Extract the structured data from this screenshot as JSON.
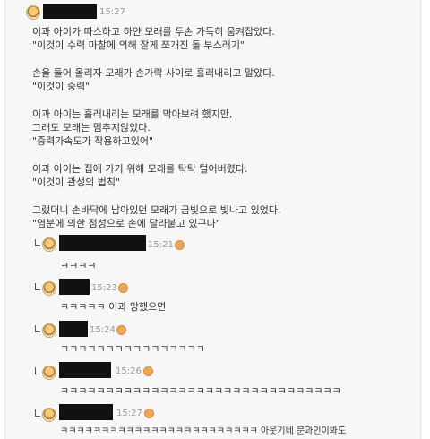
{
  "post": {
    "time": "15:27",
    "lines": [
      "이과 아이가 따스하고 하얀 모래를 두손 가득히 움켜잡았다.",
      "\"이것이 수력 마찰에 의해 잘게 쪼개진 돌 부스러기\"",
      "손을 들어 올리자 모래가 손가락 사이로 흘러내리고 말았다.",
      "\"이것이 중력\"",
      "이과 아이는 흘러내리는 모래를 막아보려 했지만,",
      "그래도 모래는 멈추지않았다.",
      "\"중력가속도가 작용하고있어\"",
      "이과 아이는 집에 가기 위해 모래를 탁탁 털어버렸다.",
      "\"이것이 관성의 법칙\"",
      "그랬더니 손바닥에 남아있던 모래가 금빛으로 빛나고 있었다.",
      "\"염분에 의한 점성으로 손에 달라붙고 있구나\""
    ]
  },
  "comments": [
    {
      "time": "15:21",
      "text": "ㅋㅋㅋㅋ"
    },
    {
      "time": "15:23",
      "text": "ㅋㅋㅋㅋㅋ 이과 망했으면"
    },
    {
      "time": "15:24",
      "text": "ㅋㅋㅋㅋㅋㅋㅋㅋㅋㅋㅋㅋㅋㅋㅋㅋ"
    },
    {
      "time": "15:26",
      "text": "ㅋㅋㅋㅋㅋㅋㅋㅋㅋㅋㅋㅋㅋㅋㅋㅋㅋㅋㅋㅋㅋㅋㅋㅋㅋㅋㅋㅋㅋㅋㅋ"
    },
    {
      "time": "15:27",
      "text": "ㅋㅋㅋㅋㅋㅋㅋㅋㅋㅋㅋㅋㅋㅋㅋㅋㅋㅋㅋㅋㅋㅋㅋㅋ 아웃기네 문과인이봐도"
    }
  ]
}
